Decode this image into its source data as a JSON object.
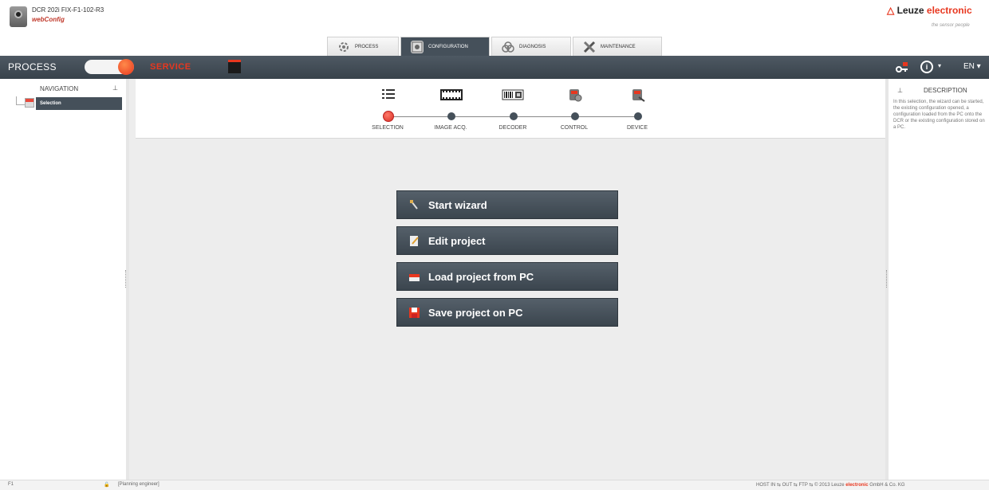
{
  "header": {
    "device_name": "DCR 202i FIX-F1-102-R3",
    "app_name": "webConfig",
    "brand_prefix": "Leuze ",
    "brand_accent": "electronic",
    "tagline": "the sensor people"
  },
  "tabs": [
    {
      "label": "PROCESS",
      "icon": "process-icon",
      "active": false
    },
    {
      "label": "CONFIGURATION",
      "icon": "configuration-icon",
      "active": true
    },
    {
      "label": "DIAGNOSIS",
      "icon": "diagnosis-icon",
      "active": false
    },
    {
      "label": "MAINTENANCE",
      "icon": "maintenance-icon",
      "active": false
    }
  ],
  "toolbar": {
    "mode_process": "PROCESS",
    "mode_service": "SERVICE",
    "info_caret": "▾",
    "language": "EN ▾"
  },
  "navigation": {
    "title": "NAVIGATION",
    "pin": "⊥",
    "items": [
      {
        "label": "Selection",
        "selected": true
      }
    ]
  },
  "wizard": {
    "steps": [
      {
        "label": "SELECTION",
        "icon": "list-icon",
        "active": true
      },
      {
        "label": "IMAGE ACQ.",
        "icon": "film-icon",
        "active": false
      },
      {
        "label": "DECODER",
        "icon": "barcode-icon",
        "active": false
      },
      {
        "label": "CONTROL",
        "icon": "control-icon",
        "active": false
      },
      {
        "label": "DEVICE",
        "icon": "device-icon",
        "active": false
      }
    ]
  },
  "actions": [
    {
      "label": "Start wizard",
      "icon": "wand-icon"
    },
    {
      "label": "Edit project",
      "icon": "edit-icon"
    },
    {
      "label": "Load project from PC",
      "icon": "load-icon"
    },
    {
      "label": "Save project on PC",
      "icon": "save-icon"
    }
  ],
  "description": {
    "title": "DESCRIPTION",
    "pin": "⊥",
    "text": "In this selection, the wizard can be started, the existing configuration opened, a configuration loaded from the PC onto the DCR or the existing configuration stored on a PC."
  },
  "status": {
    "f1": "F1",
    "role": "[Planning engineer]",
    "right_prefix": "HOST IN ⇆  OUT ⇆  FTP ⇆   © 2013 Leuze ",
    "right_accent": "electronic",
    "right_suffix": " GmbH & Co. KG"
  },
  "colors": {
    "accent": "#e8371f",
    "toolbar": "#45505a",
    "canvas": "#ededed"
  }
}
